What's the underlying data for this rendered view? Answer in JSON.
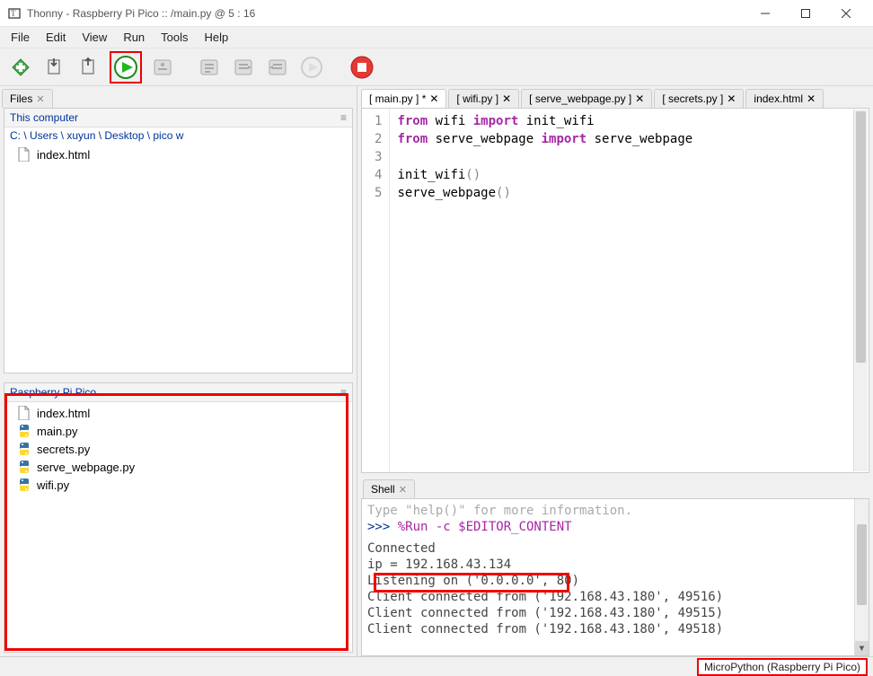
{
  "window": {
    "title": "Thonny  -  Raspberry Pi Pico :: /main.py  @  5 : 16"
  },
  "menu": [
    "File",
    "Edit",
    "View",
    "Run",
    "Tools",
    "Help"
  ],
  "files_panel": {
    "tab_label": "Files",
    "header_local": "This computer",
    "breadcrumb": "C: \\ Users \\ xuyun \\ Desktop \\ pico w",
    "local_files": [
      "index.html"
    ],
    "header_device": "Raspberry Pi Pico",
    "device_files": [
      {
        "name": "index.html",
        "kind": "file"
      },
      {
        "name": "main.py",
        "kind": "py"
      },
      {
        "name": "secrets.py",
        "kind": "py"
      },
      {
        "name": "serve_webpage.py",
        "kind": "py"
      },
      {
        "name": "wifi.py",
        "kind": "py"
      }
    ]
  },
  "editor": {
    "tabs": [
      {
        "label": "[ main.py ] *",
        "active": true
      },
      {
        "label": "[ wifi.py ]",
        "active": false
      },
      {
        "label": "[ serve_webpage.py ]",
        "active": false
      },
      {
        "label": "[ secrets.py ]",
        "active": false
      },
      {
        "label": "index.html",
        "active": false
      }
    ],
    "lines": [
      "1",
      "2",
      "3",
      "4",
      "5"
    ],
    "code_line1_kw1": "from",
    "code_line1_mod1": " wifi ",
    "code_line1_kw2": "import",
    "code_line1_mod2": " init_wifi",
    "code_line2_kw1": "from",
    "code_line2_mod1": " serve_webpage ",
    "code_line2_kw2": "import",
    "code_line2_mod2": " serve_webpage",
    "code_line4": "init_wifi",
    "code_line4_par": "()",
    "code_line5": "serve_webpage",
    "code_line5_par": "()"
  },
  "shell": {
    "tab_label": "Shell",
    "hint": "Type \"help()\" for more information.",
    "prompt": ">>> ",
    "cmd": "%Run -c $EDITOR_CONTENT",
    "out": [
      "   Connected",
      "   ip = 192.168.43.134",
      "   Listening on ('0.0.0.0', 80)",
      "   Client connected from ('192.168.43.180', 49516)",
      "   Client connected from ('192.168.43.180', 49515)",
      "   Client connected from ('192.168.43.180', 49518)"
    ]
  },
  "status": {
    "backend": "MicroPython (Raspberry Pi Pico)"
  }
}
